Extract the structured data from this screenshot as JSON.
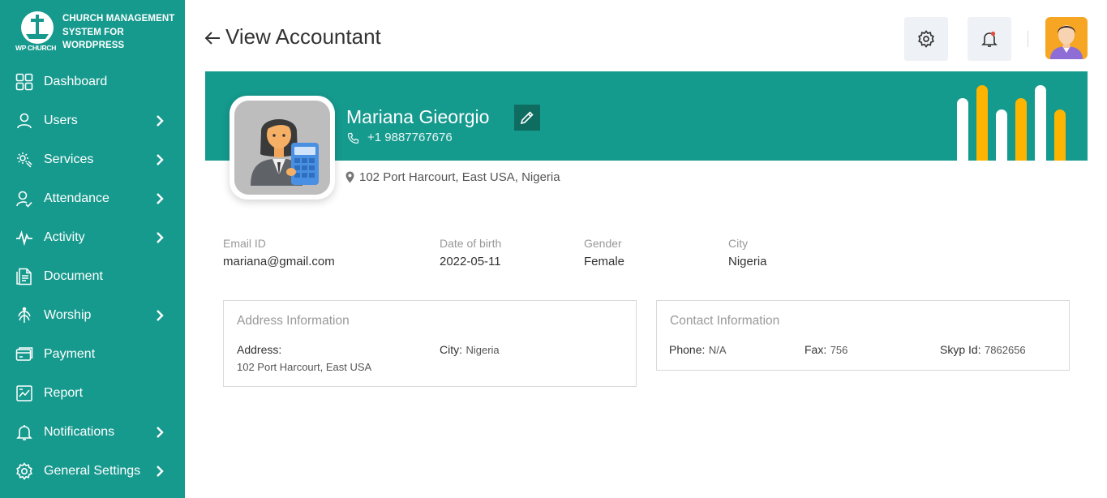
{
  "brand": {
    "title": "CHURCH MANAGEMENT SYSTEM FOR WORDPRESS",
    "title_lines": [
      "CHURCH MANAGEMENT",
      "SYSTEM FOR",
      "WORDPRESS"
    ],
    "logo_text": "WP CHURCH"
  },
  "sidebar": {
    "items": [
      {
        "label": "Dashboard",
        "icon": "dashboard-icon",
        "has_submenu": false
      },
      {
        "label": "Users",
        "icon": "user-icon",
        "has_submenu": true
      },
      {
        "label": "Services",
        "icon": "services-icon",
        "has_submenu": true
      },
      {
        "label": "Attendance",
        "icon": "attendance-icon",
        "has_submenu": true
      },
      {
        "label": "Activity",
        "icon": "activity-icon",
        "has_submenu": true
      },
      {
        "label": "Document",
        "icon": "document-icon",
        "has_submenu": false
      },
      {
        "label": "Worship",
        "icon": "worship-icon",
        "has_submenu": true
      },
      {
        "label": "Payment",
        "icon": "payment-icon",
        "has_submenu": false
      },
      {
        "label": "Report",
        "icon": "report-icon",
        "has_submenu": false
      },
      {
        "label": "Notifications",
        "icon": "bell-icon",
        "has_submenu": true
      },
      {
        "label": "General Settings",
        "icon": "gear-icon",
        "has_submenu": true
      }
    ]
  },
  "header": {
    "title": "View Accountant"
  },
  "profile": {
    "name": "Mariana Gieorgio",
    "phone": "+1 9887767676",
    "location": "102 Port Harcourt, East USA, Nigeria"
  },
  "details": {
    "email_label": "Email ID",
    "email": "mariana@gmail.com",
    "dob_label": "Date of birth",
    "dob": "2022-05-11",
    "gender_label": "Gender",
    "gender": "Female",
    "city_label": "City",
    "city": "Nigeria"
  },
  "address_card": {
    "title": "Address Information",
    "address_label": "Address:",
    "address_value": "102 Port Harcourt, East USA",
    "city_label": "City:",
    "city_value": "Nigeria"
  },
  "contact_card": {
    "title": "Contact Information",
    "phone_label": "Phone:",
    "phone_value": "N/A",
    "fax_label": "Fax:",
    "fax_value": "756",
    "skype_label": "Skyp Id:",
    "skype_value": "7862656"
  },
  "colors": {
    "primary": "#179a8e",
    "banner": "#159a8e",
    "edit_button": "#0f6c61",
    "accent_yellow": "#ffb400",
    "notification_dot": "#e74c3c"
  }
}
